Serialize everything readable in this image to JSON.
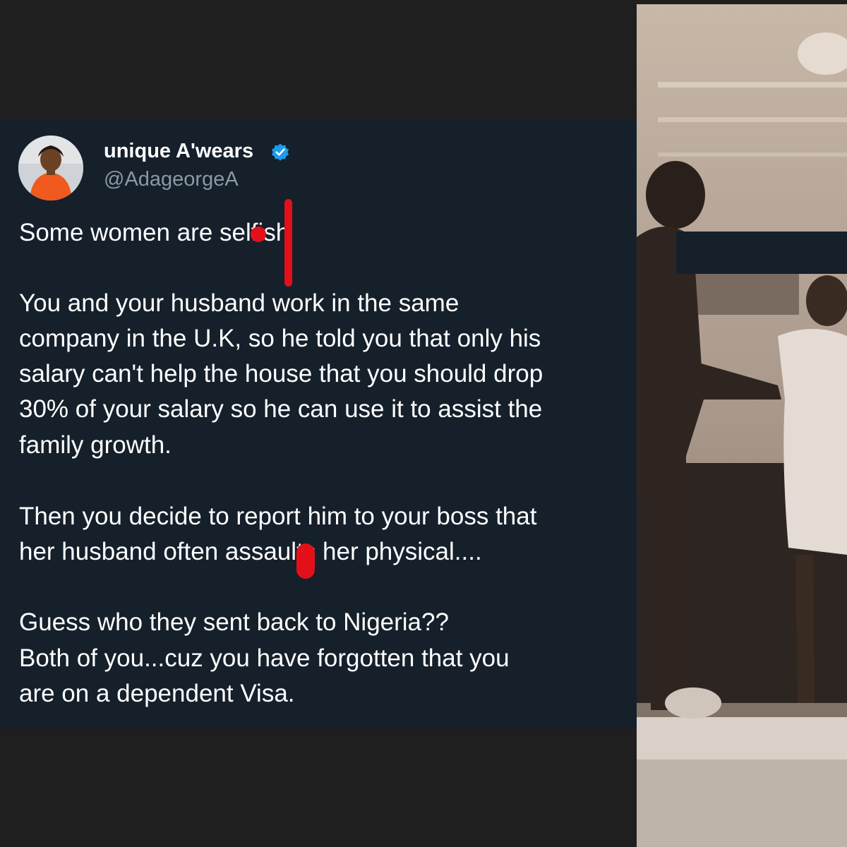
{
  "tweet": {
    "author": {
      "display_name": "unique A'wears",
      "handle": "@AdageorgeA",
      "verified": true
    },
    "lines": [
      "Some women are selfish",
      "You and your husband work in the same",
      "company in the U.K, so he told you that only his",
      "salary can't help the house that you should drop",
      "30% of your salary so he can use it to assist the",
      "family growth.",
      "Then you decide to report him to your boss that",
      "her husband often assaults her physical....",
      "Guess who they sent back to Nigeria??",
      " Both of you...cuz you have forgotten that you",
      "are on a dependent Visa."
    ]
  },
  "colors": {
    "page_background": "#1f1f1f",
    "tweet_background": "#15202b",
    "text": "#ffffff",
    "handle_text": "#8b98a5",
    "verified_badge": "#1d9bf0",
    "annotation_mark": "#e3101a",
    "photo_tone": "#8a7a69"
  },
  "icons": {
    "verified": "verified-badge-icon"
  }
}
